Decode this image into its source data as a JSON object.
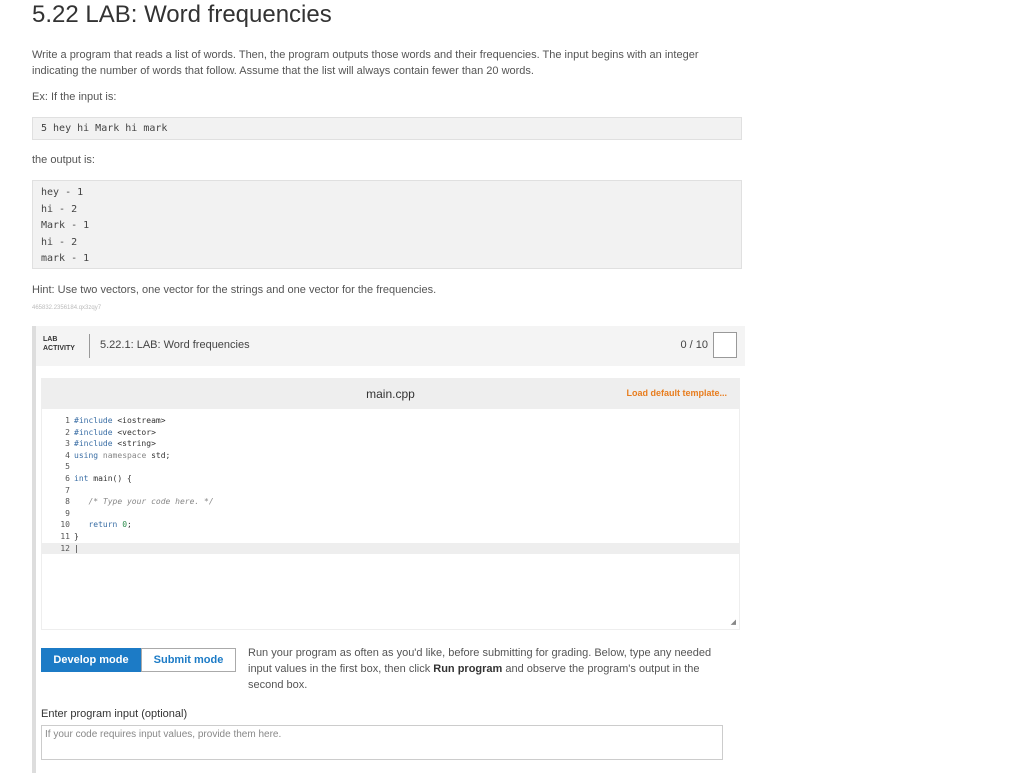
{
  "page": {
    "title": "5.22 LAB: Word frequencies",
    "description": "Write a program that reads a list of words. Then, the program outputs those words and their frequencies. The input begins with an integer indicating the number of words that follow. Assume that the list will always contain fewer than 20 words.",
    "example_intro": "Ex: If the input is:",
    "example_input": "5 hey hi Mark hi mark",
    "output_intro": "the output is:",
    "example_output": [
      "hey - 1",
      "hi - 2",
      "Mark - 1",
      "hi - 2",
      "mark - 1"
    ],
    "hint": "Hint: Use two vectors, one vector for the strings and one vector for the frequencies.",
    "tracking_code": "465832.2356184.qx3zqy7"
  },
  "lab": {
    "tag_line1": "LAB",
    "tag_line2": "ACTIVITY",
    "name": "5.22.1: LAB: Word frequencies",
    "score": "0 / 10"
  },
  "editor": {
    "filename": "main.cpp",
    "load_template": "Load default template...",
    "line_numbers": [
      "1",
      "2",
      "3",
      "4",
      "5",
      "6",
      "7",
      "8",
      "9",
      "10",
      "11",
      "12"
    ]
  },
  "modes": {
    "develop": "Develop mode",
    "submit": "Submit mode",
    "description_before": "Run your program as often as you'd like, before submitting for grading. Below, type any needed input values in the first box, then click ",
    "description_bold": "Run program",
    "description_after": " and observe the program's output in the second box."
  },
  "input": {
    "label": "Enter program input (optional)",
    "placeholder": "If your code requires input values, provide them here."
  }
}
